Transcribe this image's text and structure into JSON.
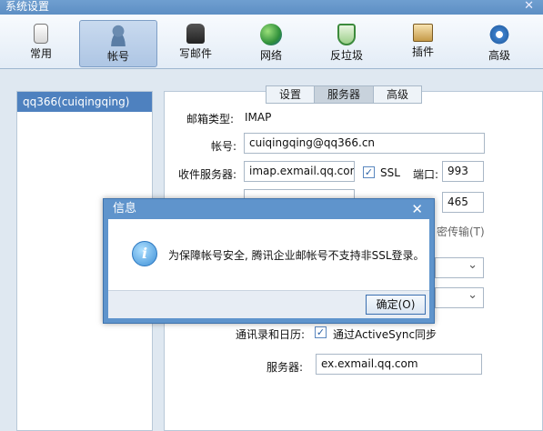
{
  "window": {
    "title": "系统设置",
    "close_glyph": "✕"
  },
  "toolbar": {
    "items": [
      {
        "label": "常用",
        "icon": "phone-icon"
      },
      {
        "label": "帐号",
        "icon": "user-icon"
      },
      {
        "label": "写邮件",
        "icon": "compose-icon"
      },
      {
        "label": "网络",
        "icon": "globe-icon"
      },
      {
        "label": "反垃圾",
        "icon": "shield-icon"
      },
      {
        "label": "插件",
        "icon": "plugin-icon"
      },
      {
        "label": "高级",
        "icon": "gear-icon"
      }
    ],
    "active_index": 1
  },
  "accounts": [
    "qq366(cuiqingqing)"
  ],
  "tabs": [
    "设置",
    "服务器",
    "高级"
  ],
  "form": {
    "mailbox_type_label": "邮箱类型:",
    "mailbox_type_value": "IMAP",
    "account_label": "帐号:",
    "account_value": "cuiqingqing@qq366.cn",
    "incoming_label": "收件服务器:",
    "incoming_value": "imap.exmail.qq.com",
    "ssl_label": "SSL",
    "port_label": "端口:",
    "port_value": "993",
    "port2_value": "465",
    "partial_text": "密传输(T)",
    "contacts_label": "通讯录和日历:",
    "activesync_label": "通过ActiveSync同步",
    "server_label": "服务器:",
    "server_value": "ex.exmail.qq.com"
  },
  "dialog": {
    "title": "信息",
    "close_glyph": "✕",
    "icon_glyph": "i",
    "message": "为保障帐号安全, 腾讯企业邮帐号不支持非SSL登录。",
    "ok_label": "确定(O)"
  },
  "colors": {
    "titlebar": "#5d8fc4",
    "selection": "#4e81bf",
    "dialog_frame": "#5f94cc"
  }
}
